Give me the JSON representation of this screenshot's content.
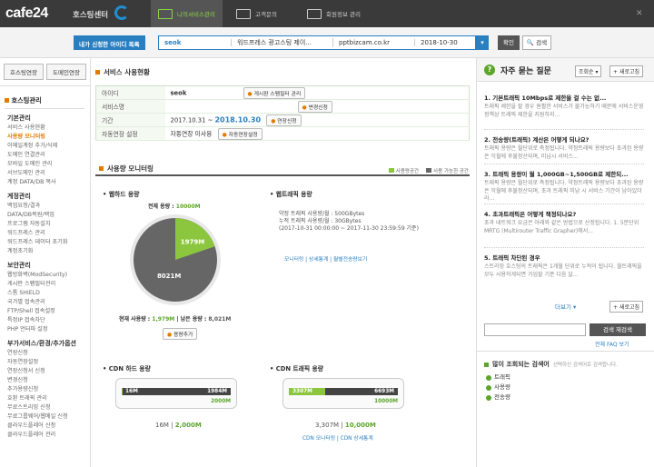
{
  "topbar": {
    "logo": "cafe24",
    "hosting_center": "호스팅센터",
    "tabs": [
      {
        "label": "나의서비스관리",
        "active": true
      },
      {
        "label": "고객문의",
        "active": false
      },
      {
        "label": "회원정보 관리",
        "active": false
      }
    ]
  },
  "search": {
    "label": "내가 신청한 아이디 목록",
    "id": "seok",
    "service": "워드프레스 광고스팅 제이...",
    "domain": "pptbizcam.co.kr",
    "date": "2018-10-30",
    "confirm": "확인",
    "search_btn": "검색"
  },
  "nav": {
    "tabs": [
      "호스팅연장",
      "도메인연장"
    ],
    "title": "호스팅관리",
    "groups": [
      {
        "heading": "기본관리",
        "items": [
          "서비스 사용현황",
          "사용량 모니터링",
          "이메일계정 추가/삭제",
          "도메인 연결관리",
          "모바일 도메인 관리",
          "서브도메인 관리",
          "계정 DATA/DB 복사"
        ]
      },
      {
        "heading": "계정관리",
        "items": [
          "백업요청/결과",
          "DATA/DB복원/백업",
          "프로그램 자동설치",
          "워드프레스 관리",
          "워드프레스 데이터 초기화",
          "계정초기화"
        ]
      },
      {
        "heading": "보안관리",
        "items": [
          "웹방화벽(ModSecurity)",
          "게시판 스팸필터관리",
          "스톰 SHIELD",
          "국가별 접속관리",
          "FTP/Shell 접속설정",
          "특정IP 접속차단",
          "PHP 언터파 설정"
        ]
      },
      {
        "heading": "부가서비스/환경/추가옵션",
        "items": [
          "연장신청",
          "자동연장설정",
          "연장신청서 신청",
          "변경신청",
          "추가용량신청",
          "호환 트래픽 관리",
          "무료스트리밍 신청",
          "무료그룹웨어/웹메일 신청",
          "클라우드플레어 신청",
          "클라우드플레어 관리"
        ]
      }
    ]
  },
  "service": {
    "title": "서비스 사용현황",
    "rows": {
      "id_label": "아이디",
      "id_value": "seok",
      "id_btn": "게시판 스팸필터 관리",
      "svc_label": "서비스명",
      "svc_btn": "변경신청",
      "period_label": "기간",
      "period_start": "2017.10.31 ~",
      "period_end": "2018.10.30",
      "period_btn": "연장신청",
      "auto_label": "자동연장 설정",
      "auto_value": "자동연장 미사용",
      "auto_btn": "자동연장설정"
    }
  },
  "monitor": {
    "title": "사용량 모니터링",
    "legend_used": "사용량공간",
    "legend_free": "사용 가능한 공간",
    "colors": {
      "used": "#8cc63f",
      "free": "#666666",
      "track": "#444444"
    },
    "web_disk": {
      "title": "웹하드 용량",
      "total_label": "전체 용량 :",
      "total_value": "10000M",
      "used_label": "1979M",
      "free_label": "8021M",
      "used_mb": 1979,
      "total_mb": 10000,
      "current_label": "현재 사용량 :",
      "current_value": "1,979M",
      "remain_label": "남은 용량 :",
      "remain_value": "8,021M",
      "add_btn": "용량추가"
    },
    "web_traffic": {
      "title": "웹트래픽 용량",
      "line1": "약정 트래픽 사용량/월 : 500GBytes",
      "line2": "누적 트래픽 사용량/월 : 30GBytes",
      "line3": "(2017-10-31 00:00:00 ~ 2017-11-30 23:59:59 기준)",
      "links": [
        "모니터링",
        "상세통계",
        "월별전송량보기"
      ]
    },
    "cdn_disk": {
      "title": "CDN 하드 용량",
      "used_label": "16M",
      "free_label": "1984M",
      "total_label": "2000M",
      "used_mb": 16,
      "total_mb": 2000,
      "used_text": "16M",
      "total_text": "2,000M"
    },
    "cdn_traffic": {
      "title": "CDN 트래픽 용량",
      "used_label": "3307M",
      "free_label": "6693M",
      "total_label": "10000M",
      "used_mb": 3307,
      "total_mb": 10000,
      "used_text": "3,307M",
      "total_text": "10,000M",
      "links": [
        "CDN 모니터링",
        "CDN 상세통계"
      ]
    }
  },
  "faq": {
    "title": "자주 묻는 질문",
    "select": "조회순",
    "new_btn": "새로고침",
    "items": [
      {
        "q": "1. 기본트래픽 10Mbps로 제한을 걸 수는 없...",
        "a": "트래픽 제한을 할 경우 원활한 서비스가 불가능하기 때문에 서비스운영 정책상 트래픽 제한을 지원하지..."
      },
      {
        "q": "2. 전송량(트래픽) 계산은 어떻게 되나요?",
        "a": "트래픽 용량은 월단위로 측정됩니다. 약정트래픽 용량보다 초과된 용량은 익월에 후불정산되며, 미납시 서비스..."
      },
      {
        "q": "3. 트래픽 용량이 월 1,000GB~1,500GB로 제한되...",
        "a": "트래픽 용량은 월단위로 측정됩니다. 약정트래픽 용량보다 초과된 용량은 익월에 후불정산되며, 초과 트래픽 미납 시 서비스 기간이 남아있더라..."
      },
      {
        "q": "4. 초과트래픽은 어떻게 책정되나요?",
        "a": "초과 네트워크 요금은 아래와 같은 방법으로 산정됩니다. 1. 5분단위 MRTG (Multirouter Traffic Grapher)에서..."
      },
      {
        "q": "5. 트래픽 차단된 경우",
        "a": "스트리밍 호스팅의 트래픽은 1개월 단위로 누적이 됩니다. 월트래픽을 모두 사용하게되면 가입할 기준 다음 달..."
      }
    ],
    "more": "더보기",
    "new_btn2": "새로고침",
    "search_btn": "검색 재검색",
    "faq_link": "전체 FAQ 보기"
  },
  "popular": {
    "title": "많이 조회되는 검색어",
    "subtitle": "선택하신 검색어로 검색합니다.",
    "items": [
      "트래픽",
      "사용량",
      "전송량"
    ]
  }
}
